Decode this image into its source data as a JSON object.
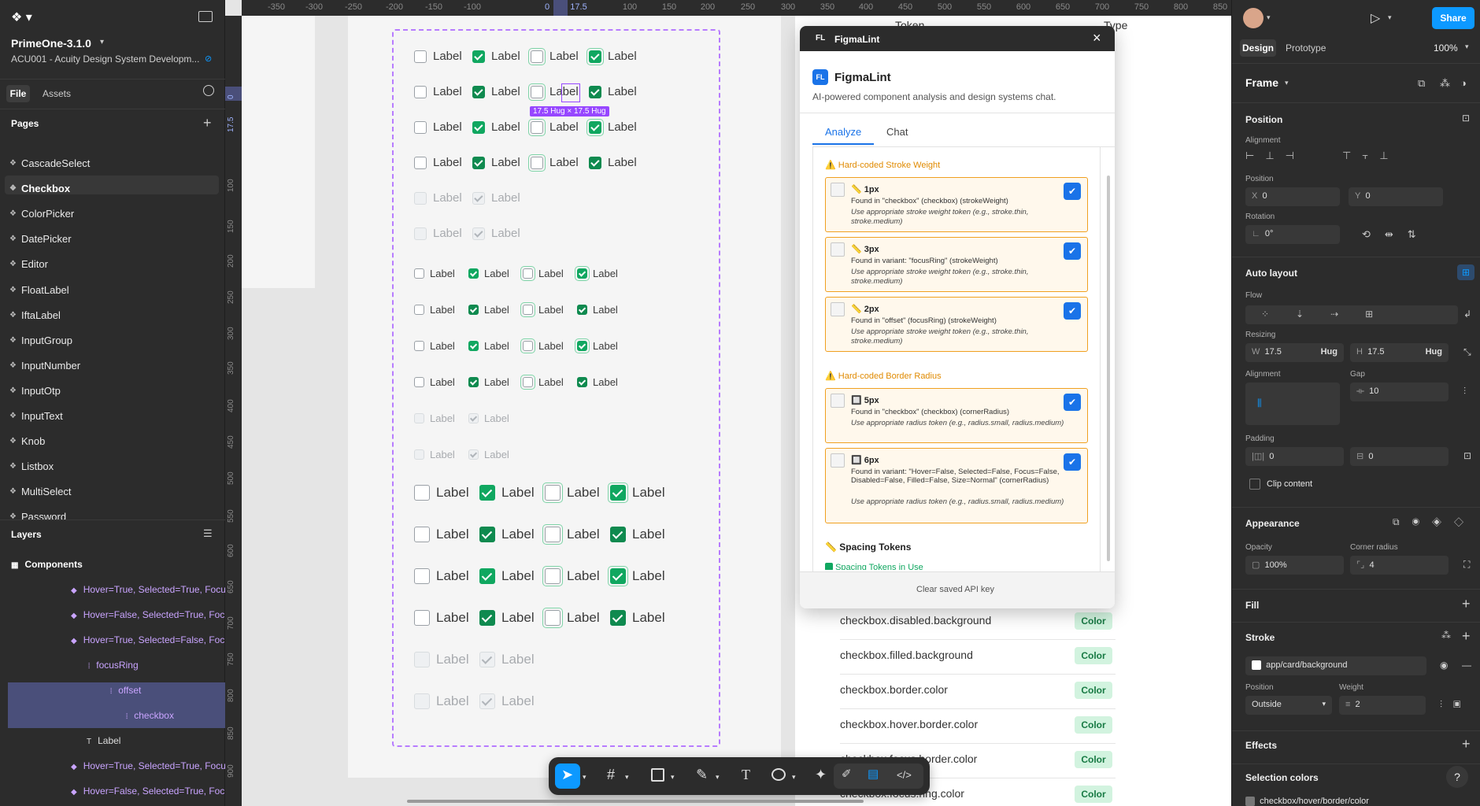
{
  "app": {
    "project_name": "PrimeOne-3.1.0",
    "file_name": "ACU001 - Acuity Design System Developm...",
    "tab_file": "File",
    "tab_assets": "Assets"
  },
  "pages": {
    "title": "Pages",
    "items": [
      "CascadeSelect",
      "Checkbox",
      "ColorPicker",
      "DatePicker",
      "Editor",
      "FloatLabel",
      "IftaLabel",
      "InputGroup",
      "InputNumber",
      "InputOtp",
      "InputText",
      "Knob",
      "Listbox",
      "MultiSelect",
      "Password"
    ]
  },
  "layers": {
    "title": "Layers",
    "items": [
      "Components",
      "Hover=True, Selected=True, Focu",
      "Hover=False, Selected=True, Foc",
      "Hover=True, Selected=False, Foc",
      "focusRing",
      "offset",
      "checkbox",
      "Label",
      "Hover=True, Selected=True, Focu",
      "Hover=False, Selected=True, Foc"
    ]
  },
  "ruler": {
    "top": [
      "-350",
      "-300",
      "-250",
      "-200",
      "-150",
      "-100",
      "0",
      "17.5",
      "100",
      "150",
      "200",
      "250",
      "300",
      "350",
      "400",
      "450",
      "500",
      "550",
      "600",
      "650",
      "700",
      "750",
      "800",
      "850"
    ],
    "left": [
      "0",
      "17.5",
      "100",
      "150",
      "200",
      "250",
      "300",
      "350",
      "400",
      "450",
      "500",
      "550",
      "600",
      "650",
      "700",
      "750",
      "800",
      "850",
      "900"
    ]
  },
  "canvas": {
    "label": "Label",
    "selection_badge": "17.5 Hug × 17.5 Hug"
  },
  "tokens": {
    "header_token": "Token",
    "header_type": "Type",
    "rows": [
      {
        "name": "checkbox.disabled.background",
        "type": "Color"
      },
      {
        "name": "checkbox.filled.background",
        "type": "Color"
      },
      {
        "name": "checkbox.border.color",
        "type": "Color"
      },
      {
        "name": "checkbox.hover.border.color",
        "type": "Color"
      },
      {
        "name": "checkbox.focus.border.color",
        "type": "Color"
      },
      {
        "name": "checkbox.focus.ring.color",
        "type": "Color"
      }
    ]
  },
  "plugin": {
    "window_title": "FigmaLint",
    "logo": "FL",
    "title": "FigmaLint",
    "subtitle": "AI-powered component analysis and design systems chat.",
    "tab_analyze": "Analyze",
    "tab_chat": "Chat",
    "section1": "Hard-coded Stroke Weight",
    "section2": "Hard-coded Border Radius",
    "section3": "Spacing Tokens",
    "section4": "Spacing Tokens in Use",
    "cards1": [
      {
        "title": "1px",
        "found": "Found in \"checkbox\" (checkbox) (strokeWeight)",
        "use": "Use appropriate stroke weight token (e.g., stroke.thin, stroke.medium)"
      },
      {
        "title": "3px",
        "found": "Found in variant: \"focusRing\" (strokeWeight)",
        "use": "Use appropriate stroke weight token (e.g., stroke.thin, stroke.medium)"
      },
      {
        "title": "2px",
        "found": "Found in \"offset\" (focusRing) (strokeWeight)",
        "use": "Use appropriate stroke weight token (e.g., stroke.thin, stroke.medium)"
      }
    ],
    "cards2": [
      {
        "title": "5px",
        "found": "Found in \"checkbox\" (checkbox) (cornerRadius)",
        "use": "Use appropriate radius token (e.g., radius.small, radius.medium)"
      },
      {
        "title": "6px",
        "found": "Found in variant: \"Hover=False, Selected=False, Focus=False, Disabled=False, Filled=False, Size=Normal\" (cornerRadius)",
        "use": "Use appropriate radius token (e.g., radius.small, radius.medium)"
      }
    ],
    "footer": "Clear saved API key"
  },
  "right": {
    "tab_design": "Design",
    "tab_prototype": "Prototype",
    "zoom": "100%",
    "share": "Share",
    "frame": "Frame",
    "position": "Position",
    "alignment": "Alignment",
    "position_label": "Position",
    "x": "X",
    "x_val": "0",
    "y": "Y",
    "y_val": "0",
    "rotation": "Rotation",
    "rotation_val": "0°",
    "auto_layout": "Auto layout",
    "flow": "Flow",
    "resizing": "Resizing",
    "w": "W",
    "w_val": "17.5",
    "w_mode": "Hug",
    "h": "H",
    "h_val": "17.5",
    "h_mode": "Hug",
    "alignment2": "Alignment",
    "gap": "Gap",
    "gap_val": "10",
    "padding": "Padding",
    "pad_h": "0",
    "pad_v": "0",
    "clip": "Clip content",
    "appearance": "Appearance",
    "opacity": "Opacity",
    "opacity_val": "100%",
    "corner": "Corner radius",
    "corner_val": "4",
    "fill": "Fill",
    "stroke": "Stroke",
    "stroke_name": "app/card/background",
    "pos": "Position",
    "pos_val": "Outside",
    "weight": "Weight",
    "weight_val": "2",
    "effects": "Effects",
    "selection_colors": "Selection colors",
    "sel_color_1": "checkbox/hover/border/color",
    "help": "?"
  },
  "colors": {
    "accent": "#0d99ff",
    "green": "#10a760",
    "purple": "#9747ff",
    "warn": "#f0a020"
  }
}
